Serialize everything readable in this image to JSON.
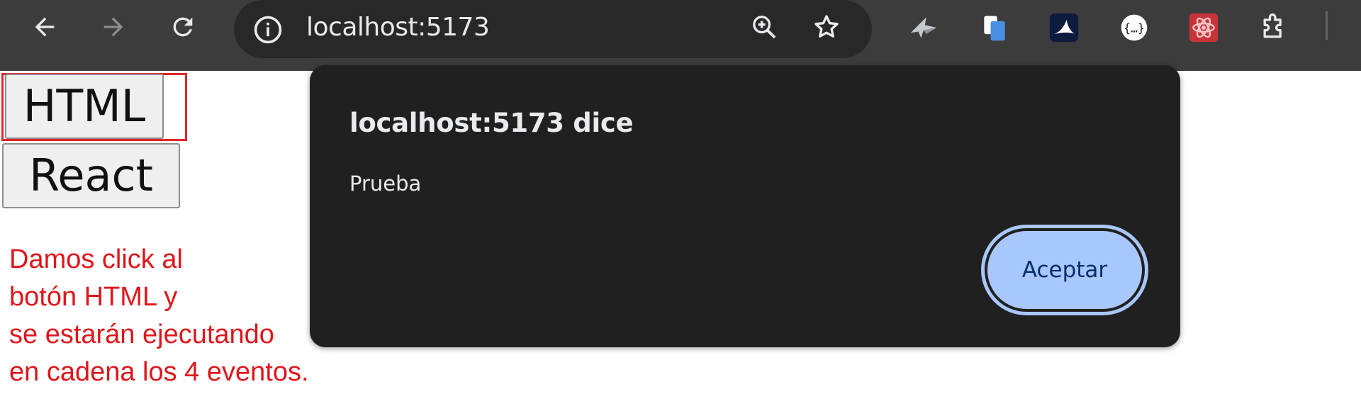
{
  "browser": {
    "url": "localhost:5173",
    "icons": {
      "back": "back-arrow-icon",
      "forward": "forward-arrow-icon",
      "reload": "reload-icon",
      "site_info": "info-icon",
      "zoom": "zoom-in-icon",
      "bookmark": "star-icon",
      "extensions": "puzzle-icon"
    }
  },
  "page": {
    "buttons": {
      "html": "HTML",
      "react": "React"
    },
    "annotation": "Damos click al\nbotón HTML y\nse estarán ejecutando\nen cadena los 4 eventos."
  },
  "dialog": {
    "title": "localhost:5173 dice",
    "message": "Prueba",
    "ok_label": "Aceptar"
  },
  "colors": {
    "toolbar_bg": "#3c3c3c",
    "omnibox_bg": "#282828",
    "dialog_bg": "#202020",
    "dialog_button": "#a8c7fa",
    "annotation_red": "#e0161b"
  }
}
